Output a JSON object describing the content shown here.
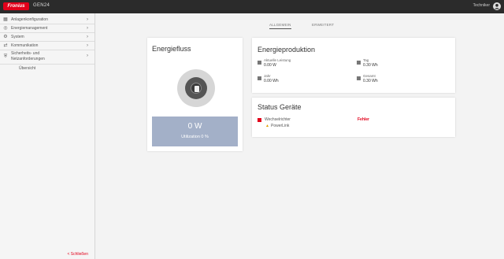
{
  "header": {
    "logo_text": "Fronius",
    "brand": "GEN24",
    "user_label": "Techniker"
  },
  "sidebar": {
    "items": [
      {
        "icon": "grid-icon",
        "label": "Anlagenkonfiguration"
      },
      {
        "icon": "energy-icon",
        "label": "Energiemanagement"
      },
      {
        "icon": "gear-icon",
        "label": "System"
      },
      {
        "icon": "network-icon",
        "label": "Kommunikation"
      },
      {
        "icon": "shield-icon",
        "label1": "Sicherheits- und",
        "label2": "Netzanforderungen"
      }
    ],
    "sub_item": "Übersicht",
    "close_label": "< Schließen"
  },
  "tabs": [
    {
      "label": "ALLGEMEIN",
      "active": true
    },
    {
      "label": "ERWEITERT",
      "active": false
    }
  ],
  "energiefluss": {
    "title": "Energiefluss",
    "power": "0 W",
    "utilization": "Utilization 0 %"
  },
  "produktion": {
    "title": "Energieproduktion",
    "metrics": [
      {
        "label": "Aktuelle Leistung",
        "value": "0.00 W"
      },
      {
        "label": "Tag",
        "value": "0.30 Wh"
      },
      {
        "label": "Jahr",
        "value": "0.00 Wh"
      },
      {
        "label": "Gesamt",
        "value": "0.30 Wh"
      }
    ]
  },
  "status": {
    "title": "Status Geräte",
    "device": "Wechselrichter",
    "device_status": "Fehler",
    "sub_device": "PowerLink"
  },
  "colors": {
    "accent": "#e2001a",
    "power_box": "#a3b0c8",
    "warning": "#e0a000"
  }
}
